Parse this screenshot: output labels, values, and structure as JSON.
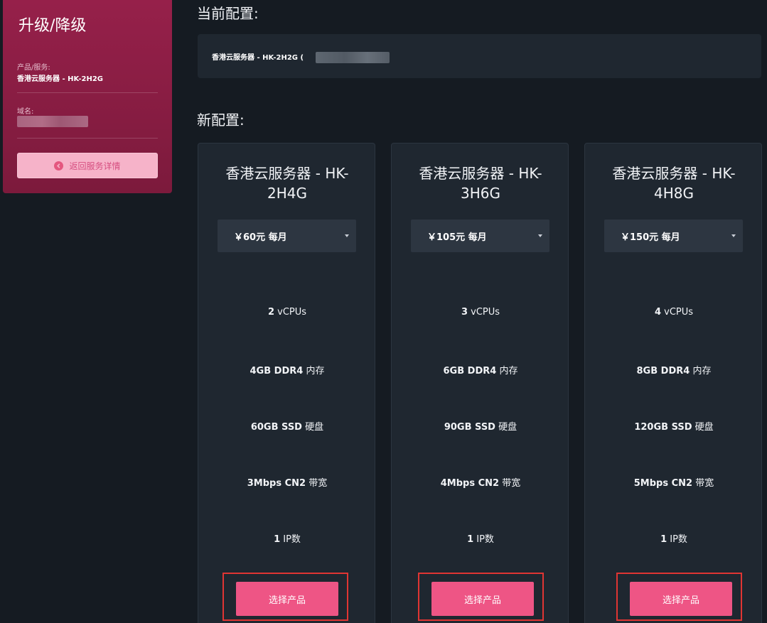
{
  "sidebar": {
    "title": "升级/降级",
    "product_label": "产品/服务:",
    "product_value": "香港云服务器 - HK-2H2G",
    "domain_label": "域名:",
    "back_button": "返回服务详情"
  },
  "current": {
    "title": "当前配置:",
    "value": "香港云服务器 - HK-2H2G (",
    "tail": ")"
  },
  "new_config": {
    "title": "新配置:",
    "choose_label": "选择产品",
    "plans": [
      {
        "name_line1": "香港云服务器 - HK-",
        "name_line2": "2H4G",
        "price": "￥60元 每月",
        "vcpu_num": "2",
        "vcpu_text": "vCPUs",
        "ram_bold": "4GB DDR4",
        "ram_text": "内存",
        "disk_bold": "60GB SSD",
        "disk_text": "硬盘",
        "bw_bold": "3Mbps CN2",
        "bw_text": "带宽",
        "ip_num": "1",
        "ip_text": "IP数"
      },
      {
        "name_line1": "香港云服务器 - HK-",
        "name_line2": "3H6G",
        "price": "￥105元 每月",
        "vcpu_num": "3",
        "vcpu_text": "vCPUs",
        "ram_bold": "6GB DDR4",
        "ram_text": "内存",
        "disk_bold": "90GB SSD",
        "disk_text": "硬盘",
        "bw_bold": "4Mbps CN2",
        "bw_text": "带宽",
        "ip_num": "1",
        "ip_text": "IP数"
      },
      {
        "name_line1": "香港云服务器 - HK-",
        "name_line2": "4H8G",
        "price": "￥150元 每月",
        "vcpu_num": "4",
        "vcpu_text": "vCPUs",
        "ram_bold": "8GB DDR4",
        "ram_text": "内存",
        "disk_bold": "120GB SSD",
        "disk_text": "硬盘",
        "bw_bold": "5Mbps CN2",
        "bw_text": "带宽",
        "ip_num": "1",
        "ip_text": "IP数"
      }
    ]
  },
  "colors": {
    "accent": "#ee5585",
    "sidebar": "#8b1e44",
    "highlight": "#e03533"
  }
}
